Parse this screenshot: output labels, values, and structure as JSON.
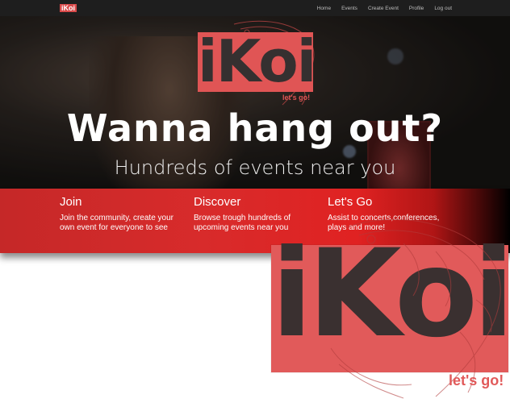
{
  "navbar": {
    "brand": "iKoi",
    "links": [
      "Home",
      "Events",
      "Create Event",
      "Profile",
      "Log out"
    ]
  },
  "hero": {
    "logo_text": "iKoi",
    "logo_tagline": "let's go!",
    "headline": "Wanna hang out?",
    "subheadline": "Hundreds of events near you"
  },
  "features": [
    {
      "title": "Join",
      "text": "Join the community, create your own event for everyone to see"
    },
    {
      "title": "Discover",
      "text": "Browse trough hundreds of upcoming events near you"
    },
    {
      "title": "Let's Go",
      "text": "Assist to concerts,conferences, plays and more!"
    }
  ],
  "big_logo": {
    "text": "iKoi",
    "tagline": "let's go!"
  },
  "colors": {
    "brand_red": "#e05555",
    "band_red": "#d82b2b",
    "nav_bg": "#1e1e1e"
  }
}
